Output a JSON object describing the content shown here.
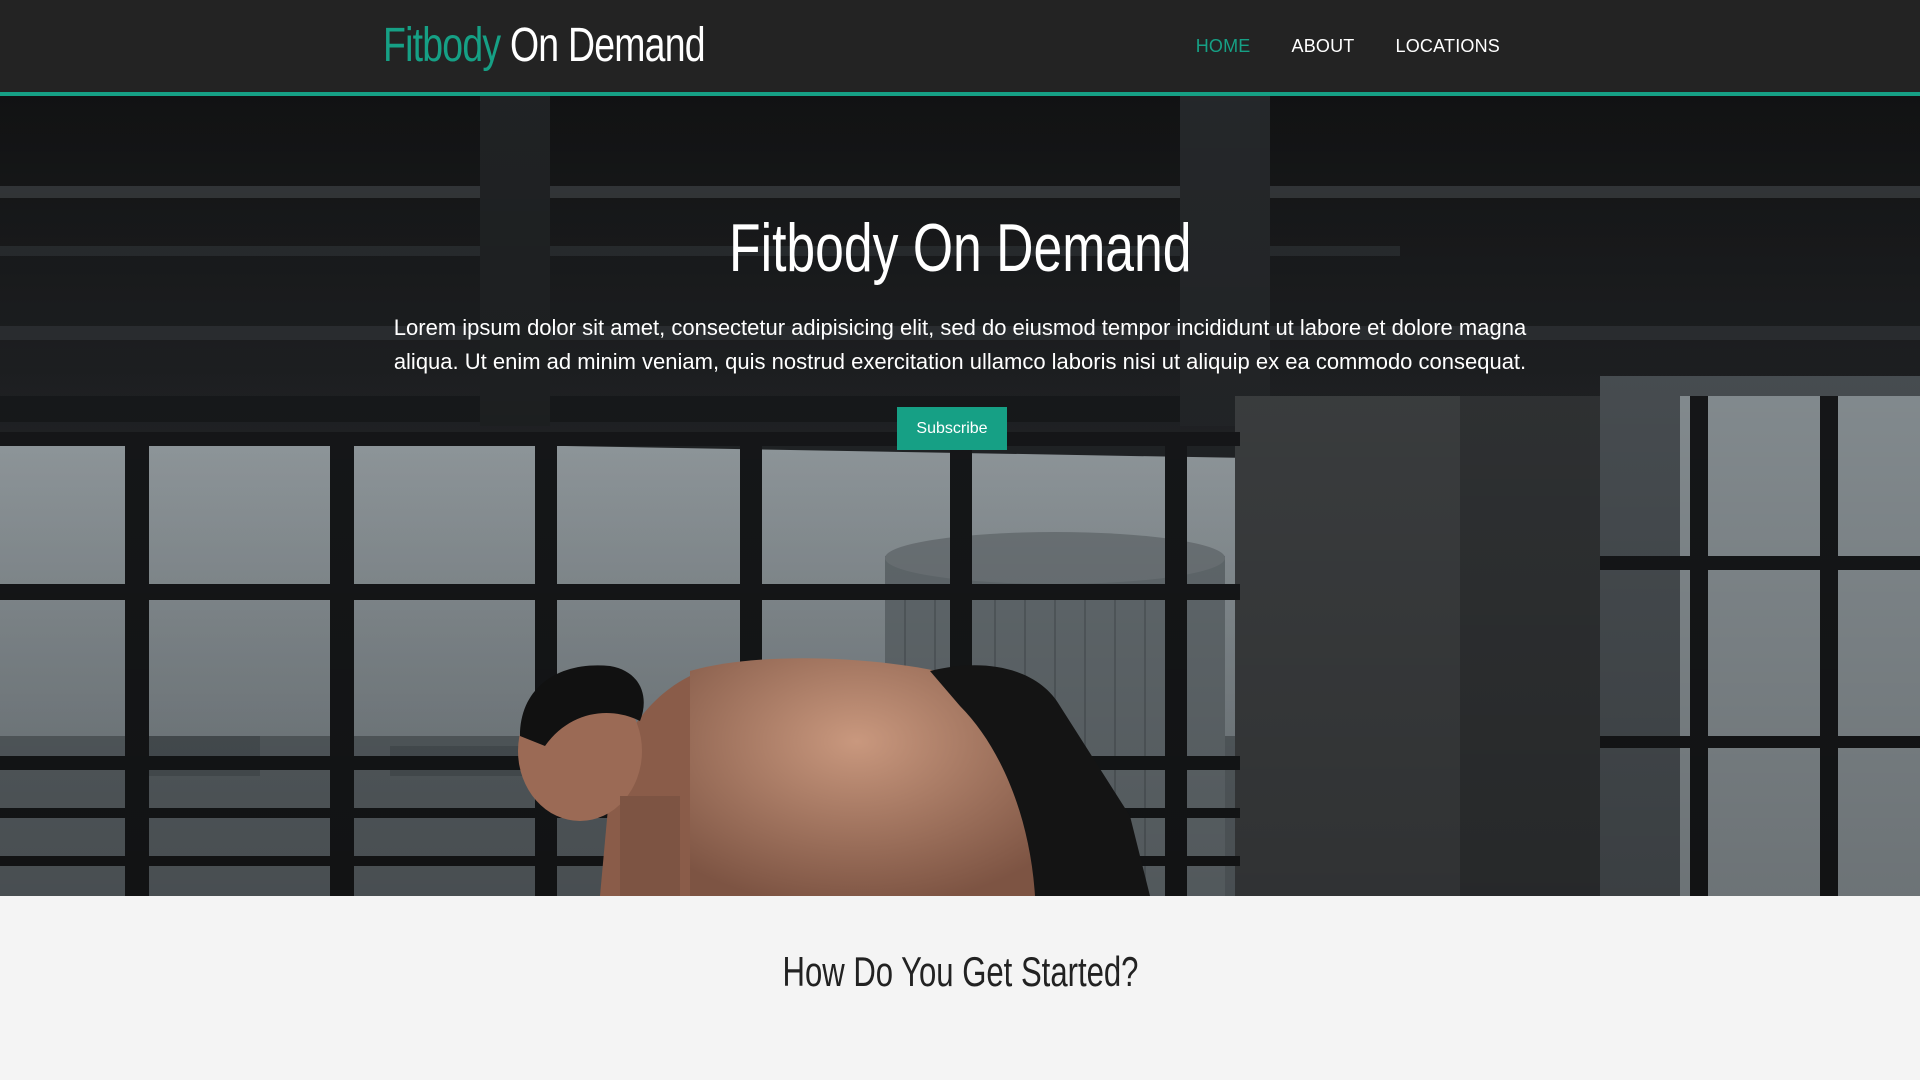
{
  "header": {
    "logo_brand": "Fitbody",
    "logo_rest": " On Demand",
    "nav": [
      {
        "label": "HOME",
        "active": true
      },
      {
        "label": "ABOUT",
        "active": false
      },
      {
        "label": "LOCATIONS",
        "active": false
      }
    ]
  },
  "hero": {
    "title": "Fitbody On Demand",
    "text": "Lorem ipsum dolor sit amet, consectetur adipisicing elit, sed do eiusmod tempor incididunt ut labore et dolore magna aliqua. Ut enim ad minim veniam, quis nostrud exercitation ullamco laboris nisi ut aliquip ex ea commodo consequat.",
    "button_label": "Subscribe"
  },
  "section": {
    "title": "How Do You Get Started?"
  },
  "colors": {
    "accent": "#16a085",
    "header_bg": "#232323",
    "section_bg": "#f4f4f4"
  }
}
